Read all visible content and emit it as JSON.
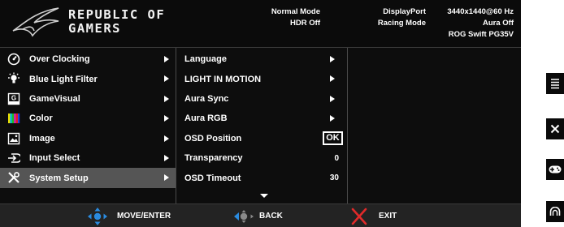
{
  "brand": {
    "line1": "REPUBLIC OF",
    "line2": "GAMERS"
  },
  "status": {
    "col1": [
      "Normal Mode",
      "HDR Off"
    ],
    "col2": [
      "DisplayPort",
      "Racing Mode"
    ],
    "col3": [
      "3440x1440@60 Hz",
      "Aura Off",
      "ROG Swift PG35V"
    ]
  },
  "main_menu": [
    {
      "label": "Over Clocking",
      "icon": "speedometer-icon"
    },
    {
      "label": "Blue Light Filter",
      "icon": "bulb-icon"
    },
    {
      "label": "GameVisual",
      "icon": "gamevisual-icon"
    },
    {
      "label": "Color",
      "icon": "color-bars-icon"
    },
    {
      "label": "Image",
      "icon": "image-icon"
    },
    {
      "label": "Input Select",
      "icon": "input-icon"
    },
    {
      "label": "System Setup",
      "icon": "wrench-icon",
      "selected": true
    }
  ],
  "sub_menu": [
    {
      "label": "Language",
      "kind": "arrow"
    },
    {
      "label": "LIGHT IN MOTION",
      "kind": "arrow"
    },
    {
      "label": "Aura Sync",
      "kind": "arrow"
    },
    {
      "label": "Aura RGB",
      "kind": "arrow"
    },
    {
      "label": "OSD Position",
      "kind": "ok",
      "value": "OK"
    },
    {
      "label": "Transparency",
      "kind": "value",
      "value": "0"
    },
    {
      "label": "OSD Timeout",
      "kind": "value",
      "value": "30"
    }
  ],
  "footer": {
    "move_enter": "MOVE/ENTER",
    "back": "BACK",
    "exit": "EXIT"
  },
  "colors": {
    "nav_blue": "#2a8be0",
    "exit_red": "#e02a2a",
    "selected_row": "#555555"
  },
  "hotkeys": [
    "menu-icon",
    "close-icon",
    "gamepad-icon",
    "wave-icon"
  ]
}
